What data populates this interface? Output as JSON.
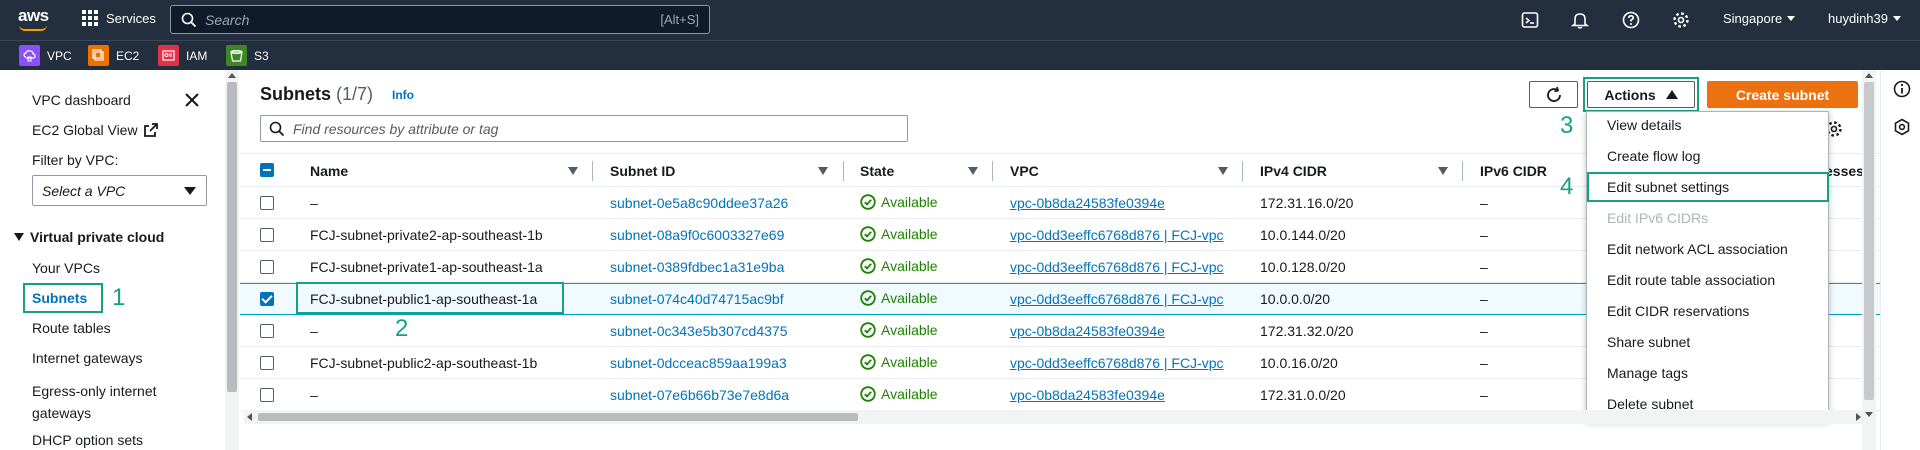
{
  "topnav": {
    "logo_text": "aws",
    "services_label": "Services",
    "search_placeholder": "Search",
    "search_shortcut": "[Alt+S]",
    "region_label": "Singapore",
    "user_label": "huydinh39",
    "icons": [
      "cloudshell-icon",
      "bell-icon",
      "help-icon",
      "gear-icon"
    ]
  },
  "favorites": [
    {
      "label": "VPC",
      "color": "#8c4fff"
    },
    {
      "label": "EC2",
      "color": "#ed7100"
    },
    {
      "label": "IAM",
      "color": "#dd344c"
    },
    {
      "label": "S3",
      "color": "#3f8624"
    }
  ],
  "sidebar": {
    "dashboard": "VPC dashboard",
    "ec2_global_view": "EC2 Global View",
    "filter_label": "Filter by VPC:",
    "filter_placeholder": "Select a VPC",
    "section": "Virtual private cloud",
    "items": [
      "Your VPCs",
      "Subnets",
      "Route tables",
      "Internet gateways",
      "Egress-only internet gateways",
      "DHCP option sets"
    ],
    "egress_line1": "Egress-only internet",
    "egress_line2": "gateways",
    "active_item": "Subnets"
  },
  "annotations": [
    "1",
    "2",
    "3",
    "4"
  ],
  "main": {
    "title": "Subnets",
    "count": "(1/7)",
    "info": "Info",
    "actions_label": "Actions",
    "create_label": "Create subnet",
    "find_placeholder": "Find resources by attribute or tag",
    "columns": [
      "Name",
      "Subnet ID",
      "State",
      "VPC",
      "IPv4 CIDR",
      "IPv6 CIDR",
      "esses"
    ],
    "rows": [
      {
        "name": "–",
        "subnet_id": "subnet-0e5a8c90ddee37a26",
        "state": "Available",
        "vpc": "vpc-0b8da24583fe0394e",
        "ipv4": "172.31.16.0/20",
        "ipv6": "–",
        "selected": false
      },
      {
        "name": "FCJ-subnet-private2-ap-southeast-1b",
        "subnet_id": "subnet-08a9f0c6003327e69",
        "state": "Available",
        "vpc": "vpc-0dd3eeffc6768d876 | FCJ-vpc",
        "ipv4": "10.0.144.0/20",
        "ipv6": "–",
        "selected": false
      },
      {
        "name": "FCJ-subnet-private1-ap-southeast-1a",
        "subnet_id": "subnet-0389fdbec1a31e9ba",
        "state": "Available",
        "vpc": "vpc-0dd3eeffc6768d876 | FCJ-vpc",
        "ipv4": "10.0.128.0/20",
        "ipv6": "–",
        "selected": false
      },
      {
        "name": "FCJ-subnet-public1-ap-southeast-1a",
        "subnet_id": "subnet-074c40d74715ac9bf",
        "state": "Available",
        "vpc": "vpc-0dd3eeffc6768d876 | FCJ-vpc",
        "ipv4": "10.0.0.0/20",
        "ipv6": "–",
        "selected": true
      },
      {
        "name": "–",
        "subnet_id": "subnet-0c343e5b307cd4375",
        "state": "Available",
        "vpc": "vpc-0b8da24583fe0394e",
        "ipv4": "172.31.32.0/20",
        "ipv6": "–",
        "selected": false
      },
      {
        "name": "FCJ-subnet-public2-ap-southeast-1b",
        "subnet_id": "subnet-0dcceac859aa199a3",
        "state": "Available",
        "vpc": "vpc-0dd3eeffc6768d876 | FCJ-vpc",
        "ipv4": "10.0.16.0/20",
        "ipv6": "–",
        "selected": false
      },
      {
        "name": "–",
        "subnet_id": "subnet-07e6b66b73e7e8d6a",
        "state": "Available",
        "vpc": "vpc-0b8da24583fe0394e",
        "ipv4": "172.31.0.0/20",
        "ipv6": "–",
        "selected": false
      }
    ]
  },
  "actions_menu": {
    "items": [
      {
        "label": "View details",
        "disabled": false
      },
      {
        "label": "Create flow log",
        "disabled": false
      },
      {
        "label": "Edit subnet settings",
        "disabled": false
      },
      {
        "label": "Edit IPv6 CIDRs",
        "disabled": true
      },
      {
        "label": "Edit network ACL association",
        "disabled": false
      },
      {
        "label": "Edit route table association",
        "disabled": false
      },
      {
        "label": "Edit CIDR reservations",
        "disabled": false
      },
      {
        "label": "Share subnet",
        "disabled": false
      },
      {
        "label": "Manage tags",
        "disabled": false
      },
      {
        "label": "Delete subnet",
        "disabled": false
      }
    ]
  },
  "colors": {
    "nav_bg": "#232f3e",
    "primary_button": "#ec7211",
    "link": "#0073bb",
    "available": "#1d8102",
    "annotation": "#16a085"
  }
}
